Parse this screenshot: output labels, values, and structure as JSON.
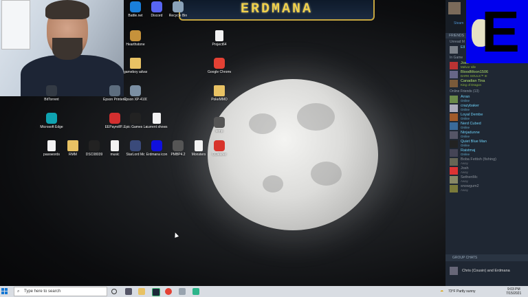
{
  "banner": {
    "title": "ERDMANA"
  },
  "desktop_icons": [
    {
      "id": "battlenet",
      "label": "Battle.net",
      "type": "app",
      "color": "#1a7fdb"
    },
    {
      "id": "discord",
      "label": "Discord",
      "type": "app",
      "color": "#5865f2"
    },
    {
      "id": "recycle",
      "label": "Recycle Bin",
      "type": "app",
      "color": "#8aa2b8"
    },
    {
      "id": "hearthstone",
      "label": "Hearthstone",
      "type": "app",
      "color": "#c6923b"
    },
    {
      "id": "project64",
      "label": "Project64",
      "type": "doc",
      "color": "#f2f2f2"
    },
    {
      "id": "gameboy",
      "label": "gameboy advanced",
      "type": "folder",
      "color": "#e8c264"
    },
    {
      "id": "chrome1",
      "label": "Google Chrome",
      "type": "app",
      "color": "#e44134"
    },
    {
      "id": "epson1",
      "label": "Epson Printer Connectio...",
      "type": "app",
      "color": "#5d6d7e"
    },
    {
      "id": "epson2",
      "label": "Epson XP-4100_X...",
      "type": "app",
      "color": "#7b8fa3"
    },
    {
      "id": "pokemmo",
      "label": "PokeMMO",
      "type": "folder",
      "color": "#e8c264"
    },
    {
      "id": "bittorrent",
      "label": "BitTorrent",
      "type": "app",
      "color": "#333a44"
    },
    {
      "id": "edge",
      "label": "Microsoft Edge",
      "type": "app",
      "color": "#0fa3b1"
    },
    {
      "id": "eepayroll",
      "label": "EEPayrollP...",
      "type": "app",
      "color": "#d32f2f"
    },
    {
      "id": "epic",
      "label": "Epic Games Launcher",
      "type": "app",
      "color": "#222222"
    },
    {
      "id": "current",
      "label": "current shows",
      "type": "doc",
      "color": "#f2f2f2"
    },
    {
      "id": "temp",
      "label": "temp",
      "type": "app",
      "color": "#555555"
    },
    {
      "id": "passwords",
      "label": "passwords",
      "type": "doc",
      "color": "#f2f2f2"
    },
    {
      "id": "rmm",
      "label": "RMM",
      "type": "folder",
      "color": "#e8c264"
    },
    {
      "id": "dsc",
      "label": "DSC08039",
      "type": "app",
      "color": "#222222"
    },
    {
      "id": "music",
      "label": "music",
      "type": "doc",
      "color": "#f2f2f2"
    },
    {
      "id": "starlord",
      "label": "StarLord Mc",
      "type": "app",
      "color": "#3a4a7a"
    },
    {
      "id": "erdmanaicon",
      "label": "Erdmana icon",
      "type": "app",
      "color": "#1010dd"
    },
    {
      "id": "pmbp",
      "label": "PMBP4.2",
      "type": "app",
      "color": "#555555"
    },
    {
      "id": "monsters",
      "label": "Monsters",
      "type": "doc",
      "color": "#f2f2f2"
    },
    {
      "id": "ccleaner",
      "label": "CCleaner",
      "type": "app",
      "color": "#d8342c"
    }
  ],
  "steam": {
    "status": "Steam",
    "friends_header": "FRIENDS",
    "sections": {
      "unread": "Unread M",
      "in_game": "In Game",
      "online": "Online Friends (13)"
    },
    "unread_friend": {
      "name": "Ell",
      "status": ""
    },
    "in_game_friends": [
      {
        "name": "Josh",
        "status": "Melvor Idle"
      },
      {
        "name": "BloodMoon1506",
        "status": "DARK SOULS™ III"
      },
      {
        "name": "Canadian Tina",
        "status": "King of Dragon"
      }
    ],
    "online_friends": [
      {
        "name": "Arran",
        "status": "Online"
      },
      {
        "name": "crazybaker",
        "status": "Online"
      },
      {
        "name": "Loyal Dembe",
        "status": "Online"
      },
      {
        "name": "Nerd Cubed",
        "status": "Online"
      },
      {
        "name": "Ninjadunne",
        "status": "Online"
      },
      {
        "name": "Quiet Blue Man",
        "status": "Online"
      },
      {
        "name": "Raistmaj",
        "status": "Online"
      }
    ],
    "away_friends": [
      {
        "name": "Boba Fettish (fishing)",
        "status": "Away"
      },
      {
        "name": "Josh",
        "status": "Away"
      },
      {
        "name": "SethenMc",
        "status": "Away"
      },
      {
        "name": "snowgum2",
        "status": "Away"
      }
    ],
    "group_chats_header": "GROUP CHATS",
    "group_chat": "Chris (Cousin) and Erdmana"
  },
  "taskbar": {
    "search_placeholder": "Type here to search",
    "weather": "73°F  Partly sunny",
    "time": "9:03 PM",
    "date": "7/15/2021"
  }
}
